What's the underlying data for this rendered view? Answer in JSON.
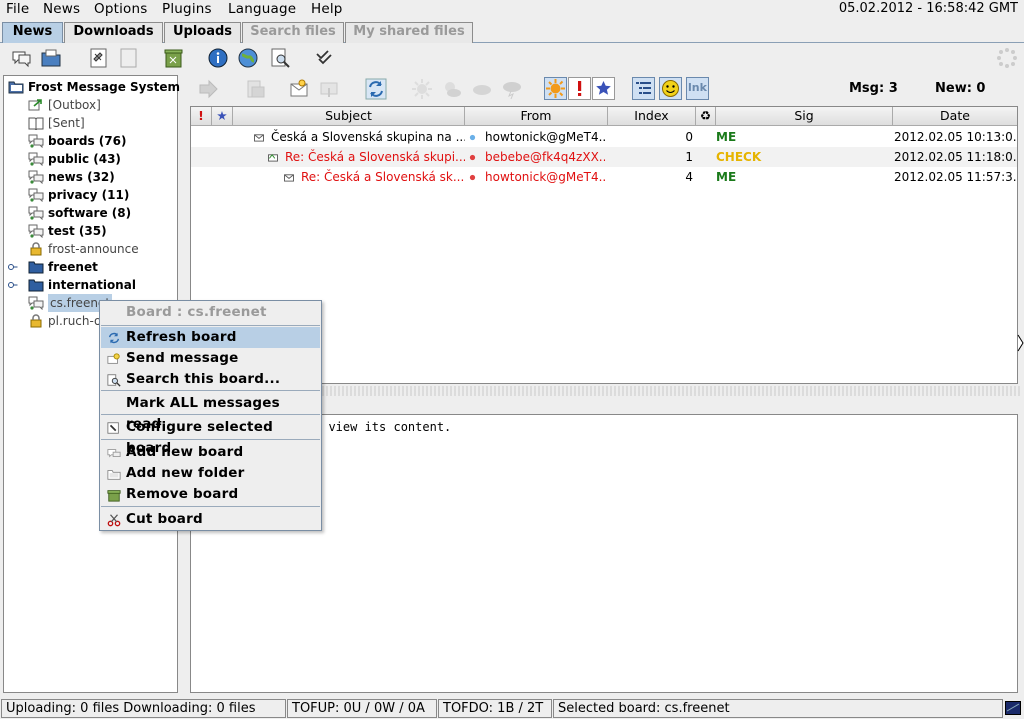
{
  "menubar": {
    "items": [
      "File",
      "News",
      "Options",
      "Plugins",
      "Language",
      "Help"
    ],
    "clock": "05.02.2012 - 16:58:42 GMT"
  },
  "tabs": [
    "News",
    "Downloads",
    "Uploads",
    "Search files",
    "My shared files"
  ],
  "tree": {
    "root": "Frost Message System",
    "items": [
      {
        "label": "[Outbox]",
        "icon": "outbox-icon",
        "bold": false
      },
      {
        "label": "[Sent]",
        "icon": "sent-book-icon",
        "bold": false
      },
      {
        "label": "boards (76)",
        "icon": "board-icon",
        "bold": true
      },
      {
        "label": "public (43)",
        "icon": "board-icon",
        "bold": true
      },
      {
        "label": "news (32)",
        "icon": "board-icon",
        "bold": true
      },
      {
        "label": "privacy (11)",
        "icon": "board-icon",
        "bold": true
      },
      {
        "label": "software (8)",
        "icon": "board-icon",
        "bold": true
      },
      {
        "label": "test (35)",
        "icon": "board-icon",
        "bold": true
      },
      {
        "label": "frost-announce",
        "icon": "lock-icon",
        "bold": false
      },
      {
        "label": "freenet",
        "icon": "folder-icon",
        "bold": true
      },
      {
        "label": "international",
        "icon": "folder-icon",
        "bold": true
      },
      {
        "label": "cs.freenet",
        "icon": "board-icon",
        "bold": false
      },
      {
        "label": "pl.ruch-o",
        "icon": "lock-icon",
        "bold": false
      }
    ]
  },
  "msgbar": {
    "msg_label": "Msg: 3",
    "new_label": "New: 0",
    "link_button": "lnk"
  },
  "table": {
    "headers": [
      "!",
      "★",
      "Subject",
      "From",
      "Index",
      "♻",
      "Sig",
      "Date"
    ],
    "rows": [
      {
        "subject": "Česká a Slovenská skupina na ...",
        "from": "howtonick@gMeT4...",
        "index": "0",
        "sig": "ME",
        "date": "2012.02.05 10:13:0...",
        "red": false,
        "sigColor": "#1a7a1a"
      },
      {
        "subject": "Re: Česká a Slovenská skupi...",
        "from": "bebebe@fk4q4zXX...",
        "index": "1",
        "sig": "CHECK",
        "date": "2012.02.05 11:18:0...",
        "red": true,
        "sigColor": "#e6b400"
      },
      {
        "subject": "Re: Česká a Slovenská sk...",
        "from": "howtonick@gMeT4...",
        "index": "4",
        "sig": "ME",
        "date": "2012.02.05 11:57:3...",
        "red": true,
        "sigColor": "#1a7a1a"
      }
    ]
  },
  "viewer": {
    "text": "o view its content."
  },
  "context_menu": {
    "title": "Board : cs.freenet",
    "items": [
      {
        "label": "Refresh board",
        "icon": "refresh-icon",
        "highlighted": true
      },
      {
        "label": "Send message",
        "icon": "send-message-icon"
      },
      {
        "label": "Search this board...",
        "icon": "search-icon"
      },
      {
        "label": "Mark ALL messages read",
        "icon": ""
      },
      {
        "label": "Configure selected board",
        "icon": "configure-icon"
      },
      {
        "label": "Add new board",
        "icon": "add-board-icon"
      },
      {
        "label": "Add new folder",
        "icon": "add-folder-icon"
      },
      {
        "label": "Remove board",
        "icon": "remove-board-icon"
      },
      {
        "label": "Cut board",
        "icon": "scissors-icon"
      }
    ]
  },
  "statusbar": {
    "transfers": "Uploading: 0 files  Downloading: 0 files",
    "tofup": "TOFUP: 0U / 0W / 0A",
    "tofdo": "TOFDO: 1B / 2T",
    "selected": "Selected board: cs.freenet"
  }
}
